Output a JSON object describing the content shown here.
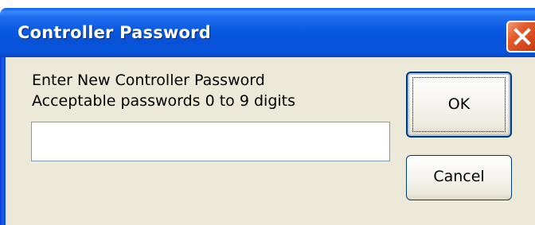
{
  "window": {
    "title": "Controller Password",
    "close_icon": "close-icon"
  },
  "dialog": {
    "line1": "Enter New Controller Password",
    "line2": "Acceptable passwords 0 to 9 digits",
    "password_value": "",
    "ok_label": "OK",
    "cancel_label": "Cancel"
  },
  "colors": {
    "titlebar": "#0a59e2",
    "close_button": "#e35a2d",
    "dialog_background": "#ece9d8",
    "button_border": "#003c74"
  }
}
